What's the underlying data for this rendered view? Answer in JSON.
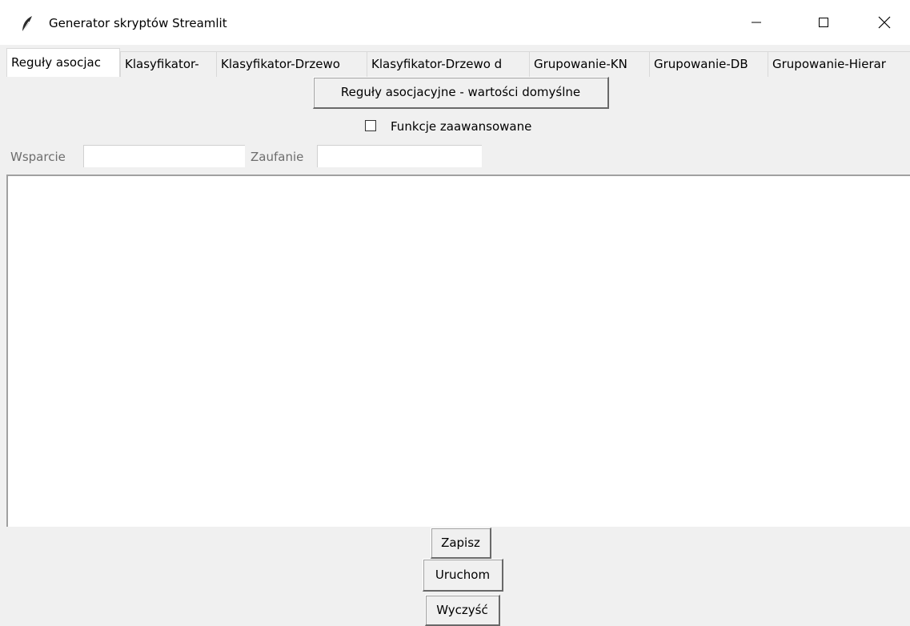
{
  "window": {
    "title": "Generator skryptów Streamlit",
    "icon": "feather-icon"
  },
  "tabs": [
    {
      "label": "Reguły asocjac",
      "active": true
    },
    {
      "label": "Klasyfikator-",
      "active": false
    },
    {
      "label": "Klasyfikator-Drzewo",
      "active": false
    },
    {
      "label": "Klasyfikator-Drzewo d",
      "active": false
    },
    {
      "label": "Grupowanie-KN",
      "active": false
    },
    {
      "label": "Grupowanie-DB",
      "active": false
    },
    {
      "label": "Grupowanie-Hierar",
      "active": false
    }
  ],
  "main": {
    "defaults_button": "Reguły asocjacyjne - wartości domyślne",
    "advanced_checkbox": {
      "label": "Funkcje zaawansowane",
      "checked": false
    },
    "support_label": "Wsparcie",
    "support_value": "",
    "confidence_label": "Zaufanie",
    "confidence_value": "",
    "output_text": ""
  },
  "actions": {
    "save": "Zapisz",
    "run": "Uruchom",
    "clear": "Wyczyść"
  },
  "colors": {
    "window_bg": "#f0f0f0",
    "titlebar_bg": "#ffffff",
    "text_area_bg": "#ffffff",
    "label_gray": "#6d6d6d"
  }
}
